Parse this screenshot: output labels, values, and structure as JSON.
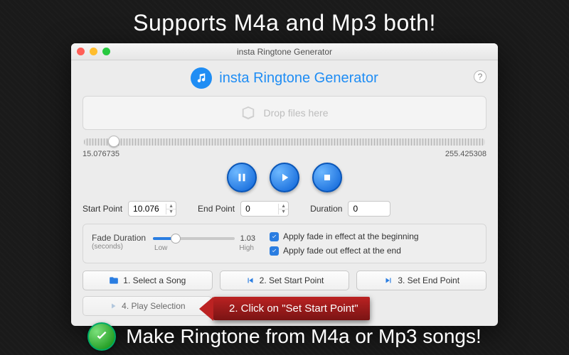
{
  "promo": {
    "top": "Supports M4a and Mp3 both!",
    "bottom": "Make Ringtone from M4a or Mp3 songs!",
    "callout": "2. Click on \"Set Start Point\""
  },
  "window": {
    "title": "insta Ringtone Generator"
  },
  "app": {
    "title": "insta Ringtone Generator",
    "help": "?"
  },
  "dropzone": {
    "label": "Drop files here"
  },
  "timeline": {
    "start": "15.076735",
    "end": "255.425308",
    "thumb_pct": 6
  },
  "points": {
    "start_label": "Start Point",
    "start_value": "10.076",
    "end_label": "End Point",
    "end_value": "0",
    "duration_label": "Duration",
    "duration_value": "0"
  },
  "fade": {
    "label": "Fade Duration",
    "unit": "(seconds)",
    "low": "Low",
    "high": "High",
    "value": "1.03",
    "pct": 28,
    "opt_in": "Apply fade in effect at the beginning",
    "opt_out": "Apply fade out effect at the end"
  },
  "steps": {
    "s1": "1. Select a Song",
    "s2": "2. Set Start Point",
    "s3": "3. Set End Point",
    "s4": "4. Play Selection"
  }
}
